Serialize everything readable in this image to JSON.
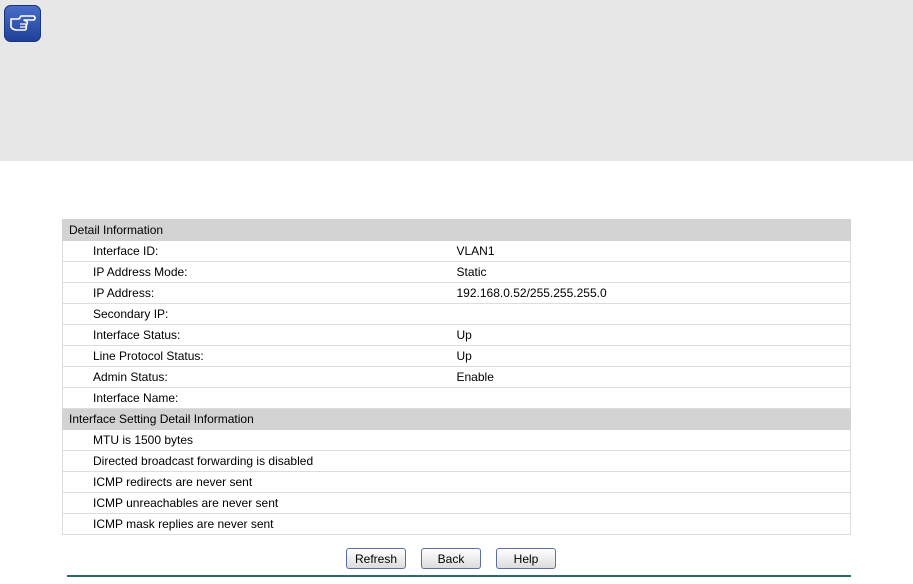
{
  "icons": {
    "note": "pointing-hand-icon"
  },
  "colors": {
    "section_header_bg": "#d3d3d3",
    "note_panel_bg": "#e7e7e7",
    "footer_rule": "#2e6b6f"
  },
  "detail": {
    "header": "Detail Information",
    "rows": [
      {
        "label": "Interface ID:",
        "value": "VLAN1"
      },
      {
        "label": "IP Address Mode:",
        "value": "Static"
      },
      {
        "label": "IP Address:",
        "value": "192.168.0.52/255.255.255.0"
      },
      {
        "label": "Secondary IP:",
        "value": ""
      },
      {
        "label": "Interface Status:",
        "value": "Up"
      },
      {
        "label": "Line Protocol Status:",
        "value": "Up"
      },
      {
        "label": "Admin Status:",
        "value": "Enable"
      },
      {
        "label": "Interface Name:",
        "value": ""
      }
    ]
  },
  "setting": {
    "header": "Interface Setting Detail Information",
    "lines": [
      "MTU is 1500 bytes",
      "Directed broadcast forwarding is disabled",
      "ICMP redirects are never sent",
      "ICMP unreachables are never sent",
      "ICMP mask replies are never sent"
    ]
  },
  "buttons": {
    "refresh": "Refresh",
    "back": "Back",
    "help": "Help"
  }
}
